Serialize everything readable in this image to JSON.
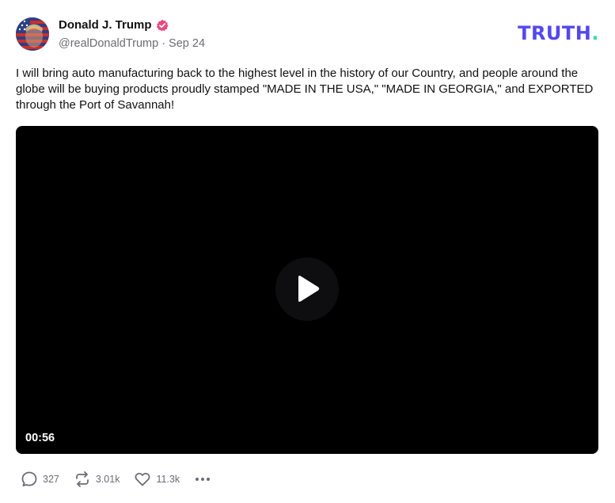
{
  "author": {
    "display_name": "Donald J. Trump",
    "handle": "@realDonaldTrump",
    "separator": "·",
    "date": "Sep 24",
    "verified": true,
    "verified_color": "#e9497c"
  },
  "brand": {
    "logo_word": "TRUTH",
    "logo_dot": ".",
    "logo_color": "#5448ee",
    "dot_color": "#3fd6b0"
  },
  "post": {
    "text": "I will bring auto manufacturing back to the highest level in the history of our Country, and people around the globe will be buying products proudly stamped \"MADE IN THE USA,\" \"MADE IN GEORGIA,\" and EXPORTED through the Port of Savannah!"
  },
  "video": {
    "duration": "00:56",
    "play_icon": "play-icon"
  },
  "actions": {
    "replies": "327",
    "reposts": "3.01k",
    "likes": "11.3k",
    "reply_icon": "reply-icon",
    "repost_icon": "repost-icon",
    "like_icon": "heart-icon",
    "more_icon": "more-icon"
  }
}
